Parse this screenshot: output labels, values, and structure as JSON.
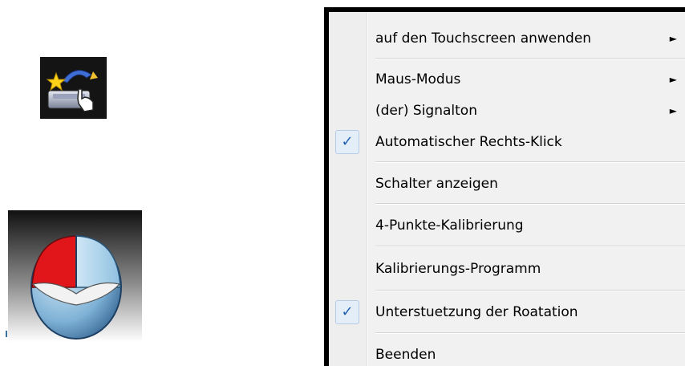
{
  "menu": {
    "items": [
      {
        "label": "auf den Touchscreen anwenden",
        "submenu": true,
        "checked": false
      },
      {
        "label": "Maus-Modus",
        "submenu": true,
        "checked": false
      },
      {
        "label": "(der) Signalton",
        "submenu": true,
        "checked": false
      },
      {
        "label": "Automatischer Rechts-Klick",
        "submenu": false,
        "checked": true
      },
      {
        "label": "Schalter anzeigen",
        "submenu": false,
        "checked": false
      },
      {
        "label": "4-Punkte-Kalibrierung",
        "submenu": false,
        "checked": false
      },
      {
        "label": "Kalibrierungs-Programm",
        "submenu": false,
        "checked": false
      },
      {
        "label": "Unterstuetzung der Roatation",
        "submenu": false,
        "checked": true
      },
      {
        "label": "Beenden",
        "submenu": false,
        "checked": false
      }
    ],
    "submenu_arrow": "►",
    "check_mark": "✓"
  },
  "icons": {
    "tray_icon": "touch-settings-icon",
    "mouse_graphic": "mouse-icon"
  },
  "colors": {
    "check_accent": "#1f5fb0",
    "mouse_left_button": "#e0161b",
    "mouse_body": "#7fb2d6"
  }
}
